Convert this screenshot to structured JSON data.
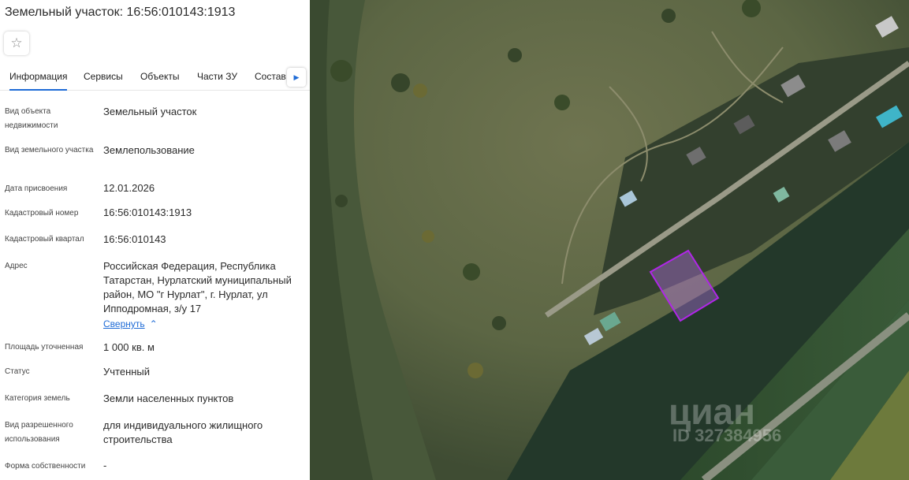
{
  "header": {
    "title": "Земельный участок: 16:56:010143:1913",
    "favorite_icon": "star-outline-icon"
  },
  "tabs": [
    {
      "label": "Информация",
      "active": true
    },
    {
      "label": "Сервисы",
      "active": false
    },
    {
      "label": "Объекты",
      "active": false
    },
    {
      "label": "Части ЗУ",
      "active": false
    },
    {
      "label": "Состав",
      "active": false
    }
  ],
  "tabs_next_icon": "triangle-right-icon",
  "info": {
    "object_type_label": "Вид объекта недвижимости",
    "object_type_value": "Земельный участок",
    "parcel_type_label": "Вид земельного участка",
    "parcel_type_value": "Землепользование",
    "assign_date_label": "Дата присвоения",
    "assign_date_value": "12.01.2026",
    "cadastral_number_label": "Кадастровый номер",
    "cadastral_number_value": "16:56:010143:1913",
    "cadastral_block_label": "Кадастровый квартал",
    "cadastral_block_value": "16:56:010143",
    "address_label": "Адрес",
    "address_value": "Российская Федерация, Республика Татарстан, Нурлатский муниципальный район, МО \"г Нурлат\", г. Нурлат, ул Ипподромная, з/у 17",
    "collapse_label": "Свернуть",
    "area_label": "Площадь уточненная",
    "area_value": "1 000 кв. м",
    "status_label": "Статус",
    "status_value": "Учтенный",
    "category_label": "Категория земель",
    "category_value": "Земли населенных пунктов",
    "permitted_use_label": "Вид разрешенного использования",
    "permitted_use_value": "для индивидуального жилищного строительства",
    "ownership_label": "Форма собственности",
    "ownership_value": "-"
  },
  "map": {
    "watermark_brand": "циан",
    "watermark_id": "ID 327384956",
    "parcel_color": "#b026e8"
  },
  "colors": {
    "accent": "#1e6bd6",
    "title_text": "#2b2b2b"
  }
}
